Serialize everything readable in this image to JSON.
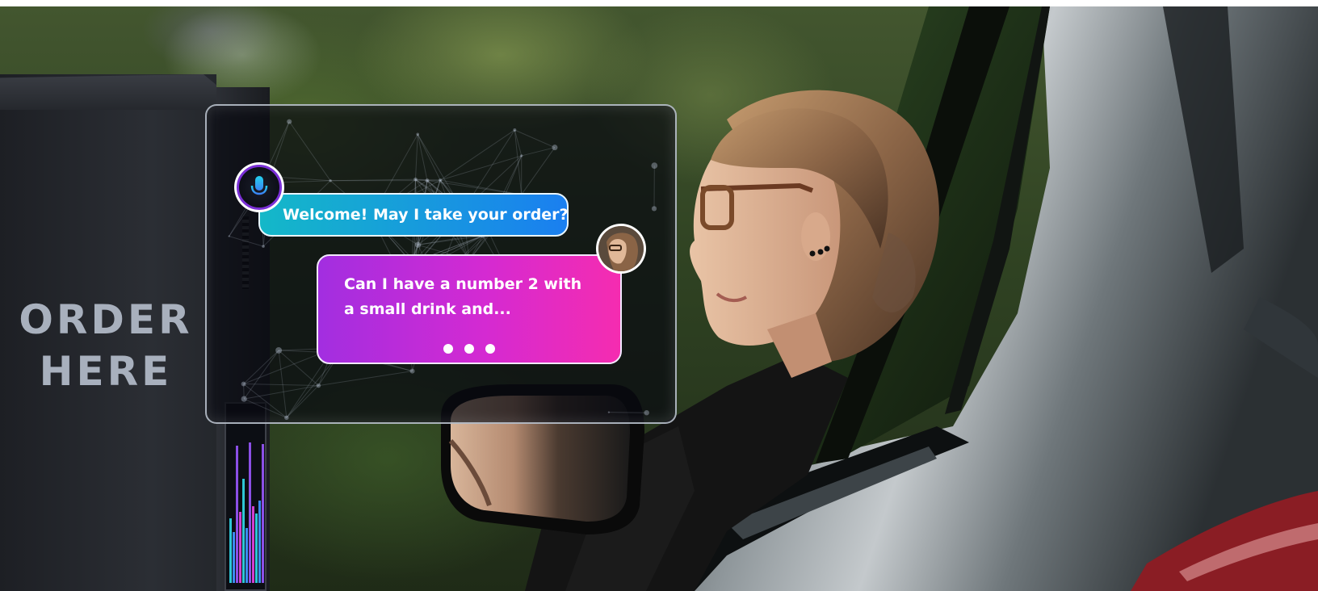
{
  "kiosk": {
    "sign_line1": "ORDER",
    "sign_line2": "HERE"
  },
  "chat": {
    "assistant_message": "Welcome! May I take your order?",
    "user_message": "Can I have a number 2 with a small drink and..."
  },
  "colors": {
    "assistant_bubble_start": "#14b8c8",
    "assistant_bubble_end": "#1a7ff0",
    "user_bubble_start": "#a22ee0",
    "user_bubble_end": "#f52cb0",
    "mic_ring": "#7a2fd6"
  },
  "icons": {
    "assistant": "microphone-icon",
    "typing": "typing-indicator-icon"
  }
}
